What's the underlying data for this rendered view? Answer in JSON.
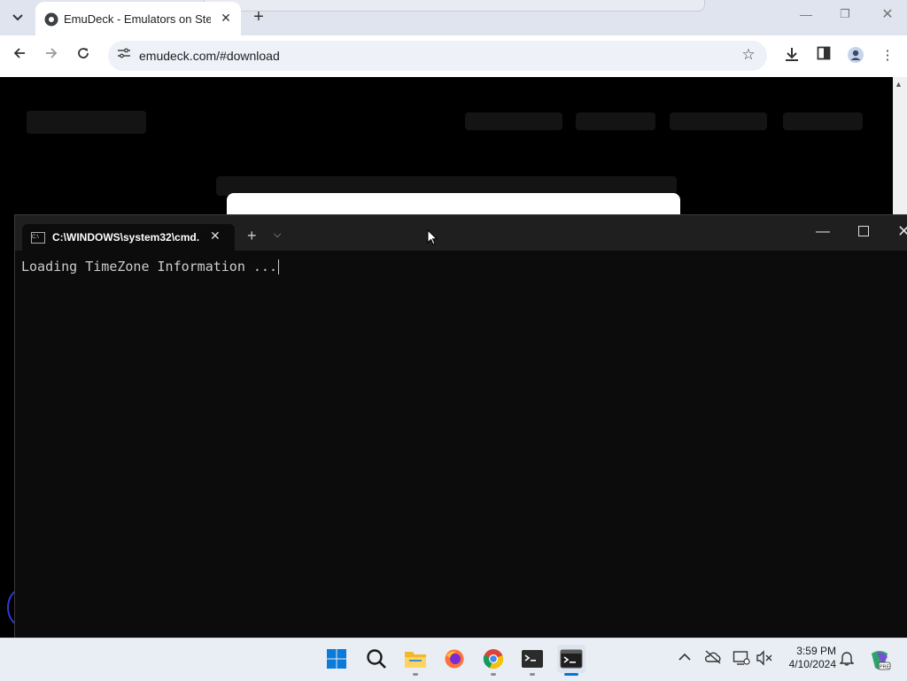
{
  "browser": {
    "tab_title": "EmuDeck - Emulators on Steam",
    "url": "emudeck.com/#download",
    "new_tab_symbol": "+",
    "tab_close_symbol": "✕"
  },
  "terminal": {
    "tab_title": "C:\\WINDOWS\\system32\\cmd.",
    "output_line": "Loading TimeZone Information ..."
  },
  "taskbar": {
    "apps": [
      "start-icon",
      "search-icon",
      "file-explorer-icon",
      "firefox-icon",
      "chrome-icon",
      "terminal-icon",
      "cmd-icon"
    ],
    "time": "3:59 PM",
    "date": "4/10/2024"
  },
  "colors": {
    "tabstrip_bg": "#dfe4ee",
    "page_bg": "#000000",
    "terminal_bg": "#0c0c0c",
    "taskbar_bg": "#e9eef5",
    "accent_blue": "#0078d4"
  }
}
